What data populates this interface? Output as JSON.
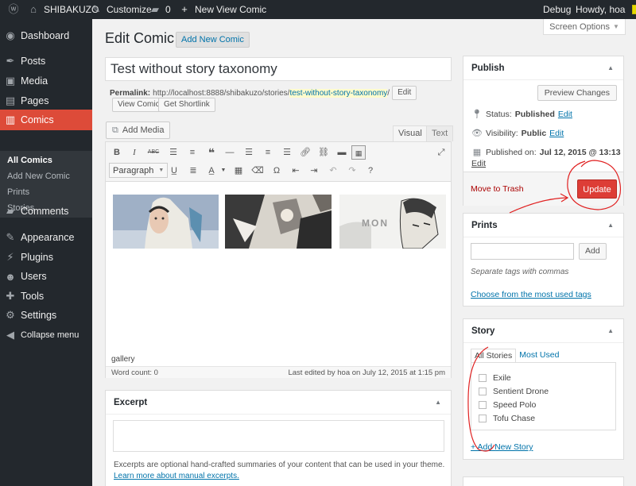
{
  "adminbar": {
    "site": "SHIBAKUZO",
    "customize": "Customize",
    "comments_count": "0",
    "new": "New",
    "view": "View Comic",
    "debug": "Debug",
    "howdy": "Howdy, hoa"
  },
  "menu": {
    "dashboard": "Dashboard",
    "posts": "Posts",
    "media": "Media",
    "pages": "Pages",
    "comics": "Comics",
    "comics_sub": [
      "All Comics",
      "Add New Comic",
      "Prints",
      "Stories"
    ],
    "comments": "Comments",
    "appearance": "Appearance",
    "plugins": "Plugins",
    "users": "Users",
    "tools": "Tools",
    "settings": "Settings",
    "collapse": "Collapse menu"
  },
  "page": {
    "title": "Edit Comic",
    "add_new": "Add New Comic",
    "screen_options": "Screen Options"
  },
  "post": {
    "title": "Test without story taxonomy",
    "permalink_label": "Permalink:",
    "permalink_base": "http://localhost:8888/shibakuzo/stories/",
    "permalink_slug": "test-without-story-taxonomy",
    "permalink_trail": "/",
    "edit_btn": "Edit",
    "view_btn": "View Comic",
    "shortlink_btn": "Get Shortlink"
  },
  "editor": {
    "add_media": "Add Media",
    "tab_visual": "Visual",
    "tab_text": "Text",
    "format": "Paragraph",
    "status": "gallery",
    "word_count": "Word count: 0",
    "last_edited": "Last edited by hoa on July 12, 2015 at 1:15 pm",
    "thumb3_text": "MON"
  },
  "excerpt": {
    "heading": "Excerpt",
    "help": "Excerpts are optional hand-crafted summaries of your content that can be used in your theme.",
    "help_link": "Learn more about manual excerpts."
  },
  "publish": {
    "heading": "Publish",
    "preview": "Preview Changes",
    "status_label": "Status:",
    "status_value": "Published",
    "visibility_label": "Visibility:",
    "visibility_value": "Public",
    "published_label": "Published on:",
    "published_value": "Jul 12, 2015 @ 13:13",
    "edit": "Edit",
    "trash": "Move to Trash",
    "update": "Update"
  },
  "prints": {
    "heading": "Prints",
    "add": "Add",
    "help": "Separate tags with commas",
    "choose": "Choose from the most used tags"
  },
  "story": {
    "heading": "Story",
    "tab_all": "All Stories",
    "tab_most": "Most Used",
    "items": [
      "Exile",
      "Sentient Drone",
      "Speed Polo",
      "Tofu Chase"
    ],
    "add_new": "+ Add New Story"
  },
  "colors": {
    "adminbar": "#23282d",
    "menu_current": "#dd4b39",
    "update": "#dd3d36",
    "link": "#0073aa",
    "annotation": "#e02020"
  }
}
